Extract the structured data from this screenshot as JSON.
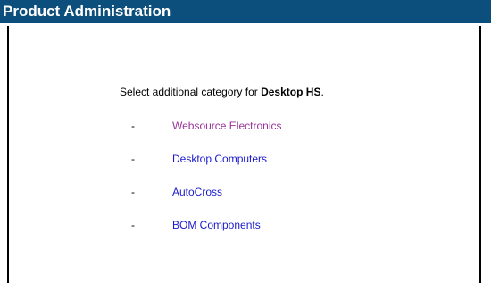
{
  "header": {
    "title": "Product Administration",
    "background_color": "#0d4f7c",
    "text_color": "#ffffff"
  },
  "prompt": {
    "text_before": "Select additional category for ",
    "product_name": "Desktop HS",
    "text_after": "."
  },
  "categories": [
    {
      "bullet": "-",
      "label": "Websource Electronics",
      "link_color": "#993399"
    },
    {
      "bullet": "-",
      "label": "Desktop Computers",
      "link_color": "#1a1acc"
    },
    {
      "bullet": "-",
      "label": "AutoCross",
      "link_color": "#1a1acc"
    },
    {
      "bullet": "-",
      "label": "BOM Components",
      "link_color": "#1a1acc"
    }
  ]
}
